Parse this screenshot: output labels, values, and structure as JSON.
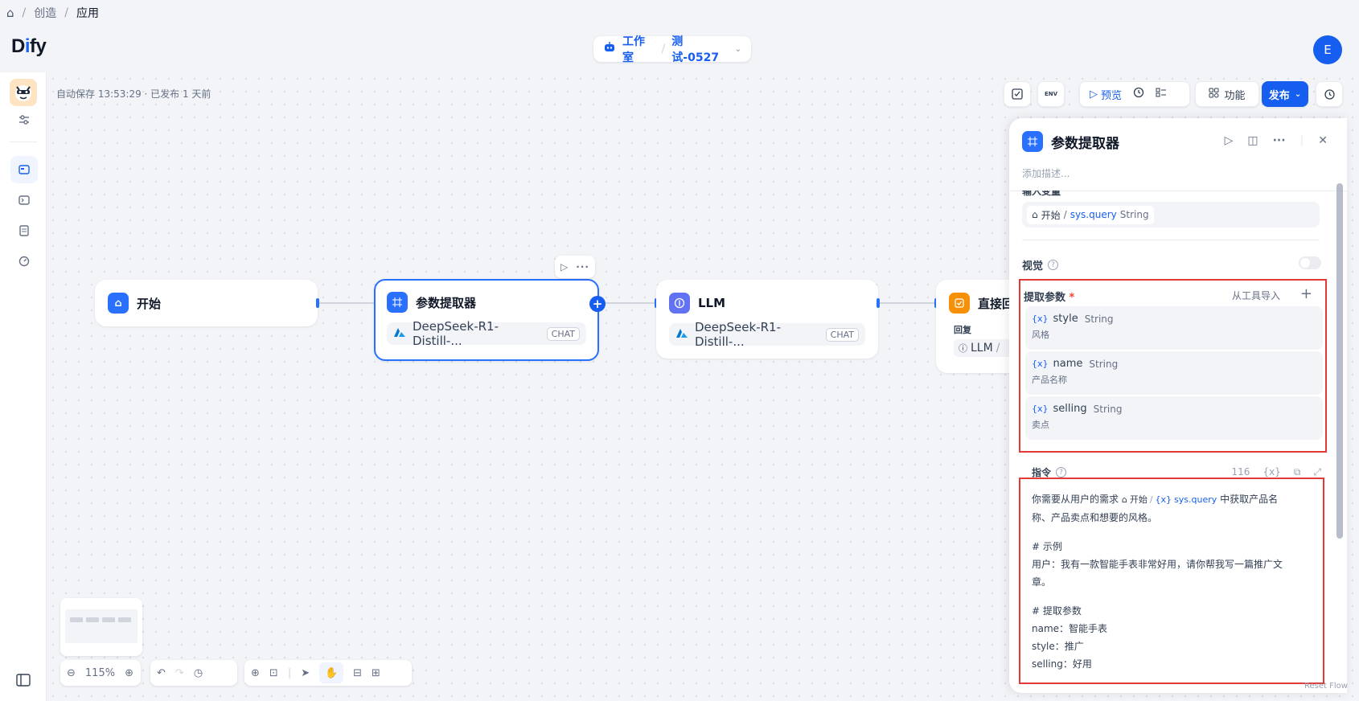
{
  "breadcrumb": {
    "home": "⌂",
    "sep": "/",
    "level1": "创造",
    "level2": "应用"
  },
  "header": {
    "logo_part1": "D",
    "logo_part2": "i",
    "logo_part3": "fy",
    "studio": "工作室",
    "app_name": "测试-0527",
    "avatar": "E"
  },
  "canvas": {
    "autosave": "自动保存 13:53:29 · 已发布 1 天前",
    "zoom": "115%"
  },
  "toolbar": {
    "env": "ENV",
    "preview": "预览",
    "features": "功能",
    "publish": "发布"
  },
  "nodes": {
    "start": {
      "title": "开始"
    },
    "extractor": {
      "title": "参数提取器",
      "model": "DeepSeek-R1-Distill-...",
      "tag": "CHAT"
    },
    "llm": {
      "title": "LLM",
      "model": "DeepSeek-R1-Distill-...",
      "tag": "CHAT"
    },
    "answer": {
      "title": "直接回",
      "sub": "回复",
      "ref_node": "LLM",
      "ref_sep": "/"
    }
  },
  "panel": {
    "title": "参数提取器",
    "description_placeholder": "添加描述...",
    "input_section_partial": "输入变量",
    "input_var": {
      "node": "开始",
      "sep": "/",
      "name": "sys.query",
      "type": "String"
    },
    "vision_label": "视觉",
    "params_label": "提取参数",
    "params_required": "*",
    "import_from_tool": "从工具导入",
    "add": "+",
    "params": [
      {
        "name": "style",
        "type": "String",
        "desc": "风格"
      },
      {
        "name": "name",
        "type": "String",
        "desc": "产品名称"
      },
      {
        "name": "selling",
        "type": "String",
        "desc": "卖点"
      }
    ],
    "instruction_label": "指令",
    "instruction_count": "116",
    "instruction_var_icon": "{x}",
    "instruction": {
      "line1_pre": "你需要从用户的需求",
      "ref_node": "开始",
      "ref_var": "sys.query",
      "line1_post": "中获取产品名",
      "line2": "称、产品卖点和想要的风格。",
      "line3": "# 示例",
      "line4": "用户：我有一款智能手表非常好用，请你帮我写一篇推广文",
      "line5": "章。",
      "line6": "# 提取参数",
      "line7": "name：智能手表",
      "line8": "style：推广",
      "line9": "selling：好用"
    }
  },
  "reset_flow": "Reset Flow"
}
